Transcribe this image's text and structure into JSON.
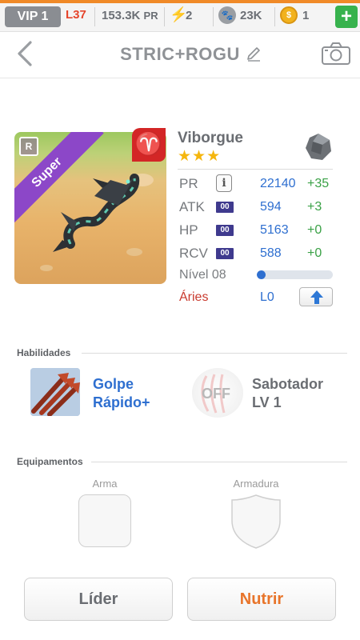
{
  "topbar": {
    "vip": "VIP 1",
    "level": "L37",
    "power": "153.3K",
    "power_unit": "PR",
    "energy": "2",
    "food": "23K",
    "coins": "1",
    "accent_color": "#f08a28"
  },
  "header": {
    "title": "STRIC+ROGU",
    "icons": [
      "back-chevron-icon",
      "pencil-icon",
      "camera-icon"
    ]
  },
  "monster": {
    "name": "Viborgue",
    "stars": "★★★",
    "rarity": "Super",
    "rarity_badge": "R",
    "zodiac_glyph": "♈",
    "stats": [
      {
        "label": "PR",
        "icon": "i",
        "value": "22140",
        "bonus": "+35"
      },
      {
        "label": "ATK",
        "icon": "00",
        "value": "594",
        "bonus": "+3"
      },
      {
        "label": "HP",
        "icon": "00",
        "value": "5163",
        "bonus": "+0"
      },
      {
        "label": "RCV",
        "icon": "00",
        "value": "588",
        "bonus": "+0"
      }
    ],
    "level_label": "Nível 08",
    "level_progress": 0.12,
    "sign_label": "Áries",
    "sign_level": "L0"
  },
  "skills": {
    "section_title": "Habilidades",
    "skill1_line1": "Golpe",
    "skill1_line2": "Rápido+",
    "off_label": "OFF",
    "skill2_line1": "Sabotador",
    "skill2_line2": "LV 1"
  },
  "equipment": {
    "section_title": "Equipamentos",
    "weapon_label": "Arma",
    "armor_label": "Armadura"
  },
  "actions": {
    "leader": "Líder",
    "feed": "Nutrir"
  }
}
